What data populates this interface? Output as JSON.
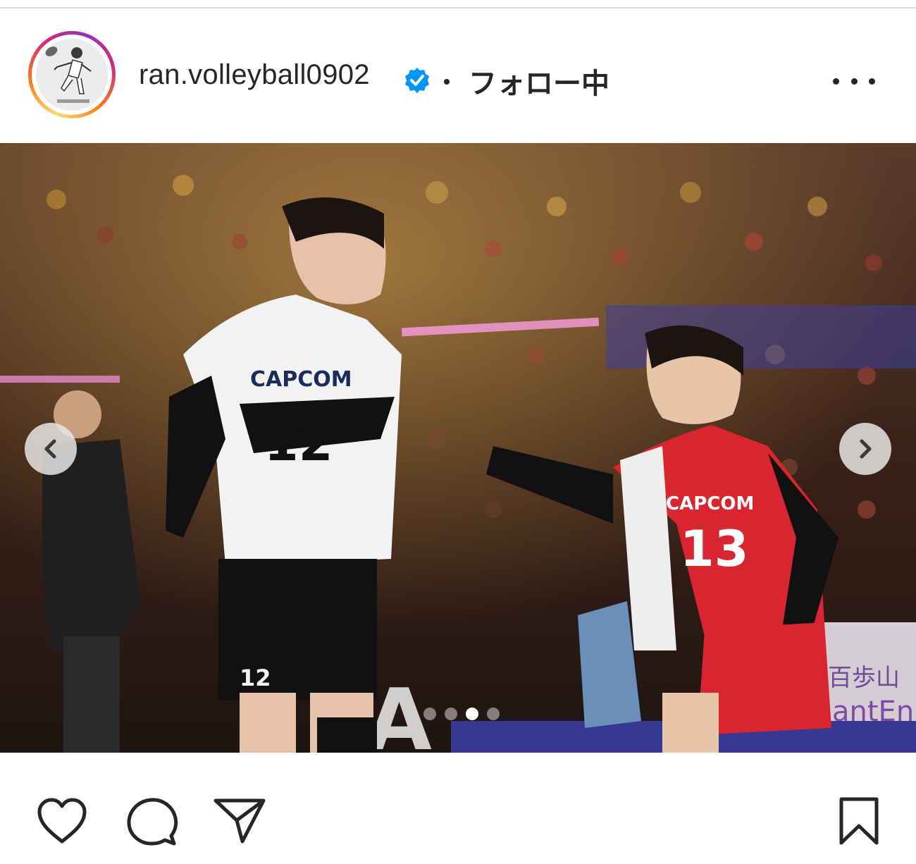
{
  "post": {
    "username": "ran.volleyball0902",
    "separator": "•",
    "follow_status": "フォロー中",
    "verified_icon": "verified-badge-icon",
    "more_icon": "more-options-icon"
  },
  "carousel": {
    "total_slides": 4,
    "active_slide": 3,
    "prev_icon": "chevron-left-icon",
    "next_icon": "chevron-right-icon"
  },
  "photo": {
    "jersey_left_brand": "CAPCOM",
    "jersey_left_number": "12",
    "shorts_left_number": "12",
    "jersey_right_brand": "CAPCOM",
    "jersey_right_number": "13",
    "board_text": "A",
    "sign_text_1": "百歩山",
    "sign_text_2": "GantEn"
  },
  "actions": {
    "like_icon": "heart-icon",
    "comment_icon": "comment-icon",
    "share_icon": "paper-plane-icon",
    "save_icon": "bookmark-icon"
  },
  "colors": {
    "verified_blue": "#0095f6",
    "text": "#262626",
    "jersey_red": "#d9252f"
  }
}
